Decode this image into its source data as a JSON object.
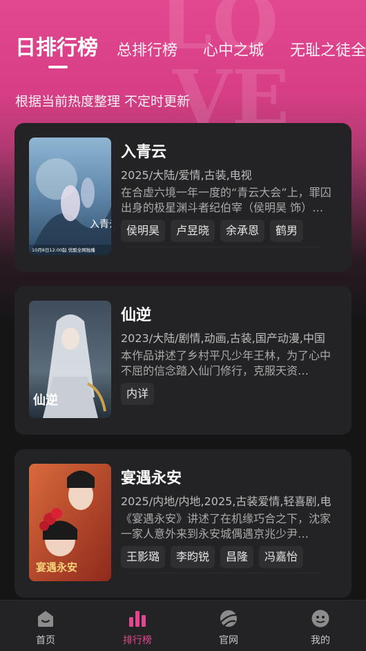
{
  "tabs": [
    {
      "label": "日排行榜",
      "active": true
    },
    {
      "label": "总排行榜",
      "active": false
    },
    {
      "label": "心中之城",
      "active": false
    },
    {
      "label": "无耻之徒全",
      "active": false
    }
  ],
  "subtitle": "根据当前热度整理 不定时更新",
  "cards": [
    {
      "title": "入青云",
      "meta": "2025/大陆/爱情,古装,电视",
      "desc": "在合虚六境一年一度的“青云大会”上，罪囚出身的极星渊斗者纪伯宰（侯明昊 饰）…",
      "tags": [
        "侯明昊",
        "卢昱晓",
        "余承恩",
        "鹤男"
      ],
      "poster_text": "10月8日12:00起 优酷全网独播",
      "poster_title": "入青云"
    },
    {
      "title": "仙逆",
      "meta": "2023/大陆/剧情,动画,古装,国产动漫,中国",
      "desc": "本作品讲述了乡村平凡少年王林，为了心中不屈的信念踏入仙门修行，克服天资…",
      "tags": [
        "内详"
      ],
      "poster_title": "仙逆"
    },
    {
      "title": "宴遇永安",
      "meta": "2025/内地/内地,2025,古装爱情,轻喜剧,电",
      "desc": "《宴遇永安》讲述了在机缘巧合之下，沈家一家人意外来到永安城偶遇京兆少尹…",
      "tags": [
        "王影璐",
        "李昀锐",
        "昌隆",
        "冯嘉怡"
      ],
      "poster_title": "宴遇永安"
    }
  ],
  "nav": [
    {
      "label": "首页",
      "icon": "home-icon",
      "active": false
    },
    {
      "label": "排行榜",
      "icon": "ranking-icon",
      "active": true
    },
    {
      "label": "官网",
      "icon": "planet-icon",
      "active": false
    },
    {
      "label": "我的",
      "icon": "profile-icon",
      "active": false
    }
  ],
  "colors": {
    "accent": "#e2488f",
    "card": "#232325",
    "background": "#151516"
  }
}
